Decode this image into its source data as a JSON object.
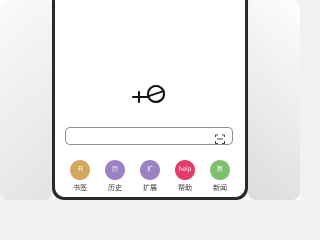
{
  "search": {
    "value": "",
    "placeholder": ""
  },
  "shortcuts": [
    {
      "label": "书签",
      "icon_text": "书",
      "color": "#d0a85f"
    },
    {
      "label": "历史",
      "icon_text": "历",
      "color": "#9b82c3"
    },
    {
      "label": "扩展",
      "icon_text": "扩",
      "color": "#9b82c3"
    },
    {
      "label": "帮助",
      "icon_text": "help",
      "color": "#e43b67"
    },
    {
      "label": "新闻",
      "icon_text": "新",
      "color": "#7fc06e"
    }
  ],
  "logo": {
    "icon": "browser-logo-icon"
  },
  "scan": {
    "icon": "scan-icon"
  }
}
